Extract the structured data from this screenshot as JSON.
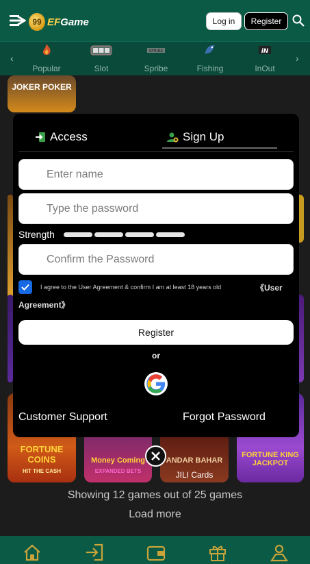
{
  "header": {
    "logo_text_ef": "EF",
    "logo_text_game": "Game",
    "login_label": "Log in",
    "register_label": "Register"
  },
  "categories": [
    {
      "label": "Popular",
      "icon": "flame-icon"
    },
    {
      "label": "Slot",
      "icon": "slot-machine-icon"
    },
    {
      "label": "Spribe",
      "icon": "spribe-icon"
    },
    {
      "label": "Fishing",
      "icon": "fish-icon"
    },
    {
      "label": "InOut",
      "icon": "inout-icon"
    }
  ],
  "games": {
    "tile_top": "JOKER POKER",
    "tile1": "FORTUNE COINS",
    "tile1_sub": "HIT THE CASH",
    "tile2": "Money Coming",
    "tile2_sub": "EXPANDED BETS",
    "tile3": "ANDAR BAHAR",
    "tile3_provider": "JILI Cards",
    "tile4": "FORTUNE KING JACKPOT",
    "showing_text": "Showing 12 games out of 25 games",
    "load_more": "Load more"
  },
  "modal": {
    "tab_access": "Access",
    "tab_signup": "Sign Up",
    "name_placeholder": "Enter name",
    "password_placeholder": "Type the password",
    "strength_label": "Strength",
    "confirm_placeholder": "Confirm the Password",
    "agree_text": "I agree to the User Agreement & confirm I am at least 18 years old",
    "agree_link_1": "《User",
    "agree_link_2": "Agreement》",
    "register_button": "Register",
    "or_text": "or",
    "customer_support": "Customer Support",
    "forgot_password": "Forgot Password"
  },
  "colors": {
    "header_green": "#0b5a45",
    "checkbox_blue": "#1668e3"
  }
}
